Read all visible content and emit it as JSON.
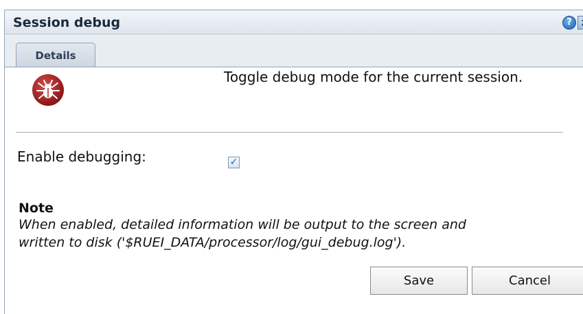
{
  "dialog": {
    "title": "Session debug",
    "help_icon": "help-icon",
    "help_glyph": "?",
    "close_icon": "close-icon",
    "close_glyph": "x"
  },
  "tabs": [
    {
      "label": "Details",
      "selected": true
    }
  ],
  "content": {
    "icon": "bug-icon",
    "description": "Toggle debug mode for the current session.",
    "enable_label": "Enable debugging:",
    "enable_checked": true,
    "note_heading": "Note",
    "note_text": "When enabled, detailed information will be output to the screen and\nwritten to disk ('$RUEI_DATA/processor/log/gui_debug.log')."
  },
  "buttons": {
    "save_label": "Save",
    "cancel_label": "Cancel"
  },
  "colors": {
    "titlebar": "#dde5ee",
    "tab_background": "#cdd6e0",
    "icon_red": "#8e1717",
    "checkbox_mark": "#2a5aa8"
  }
}
